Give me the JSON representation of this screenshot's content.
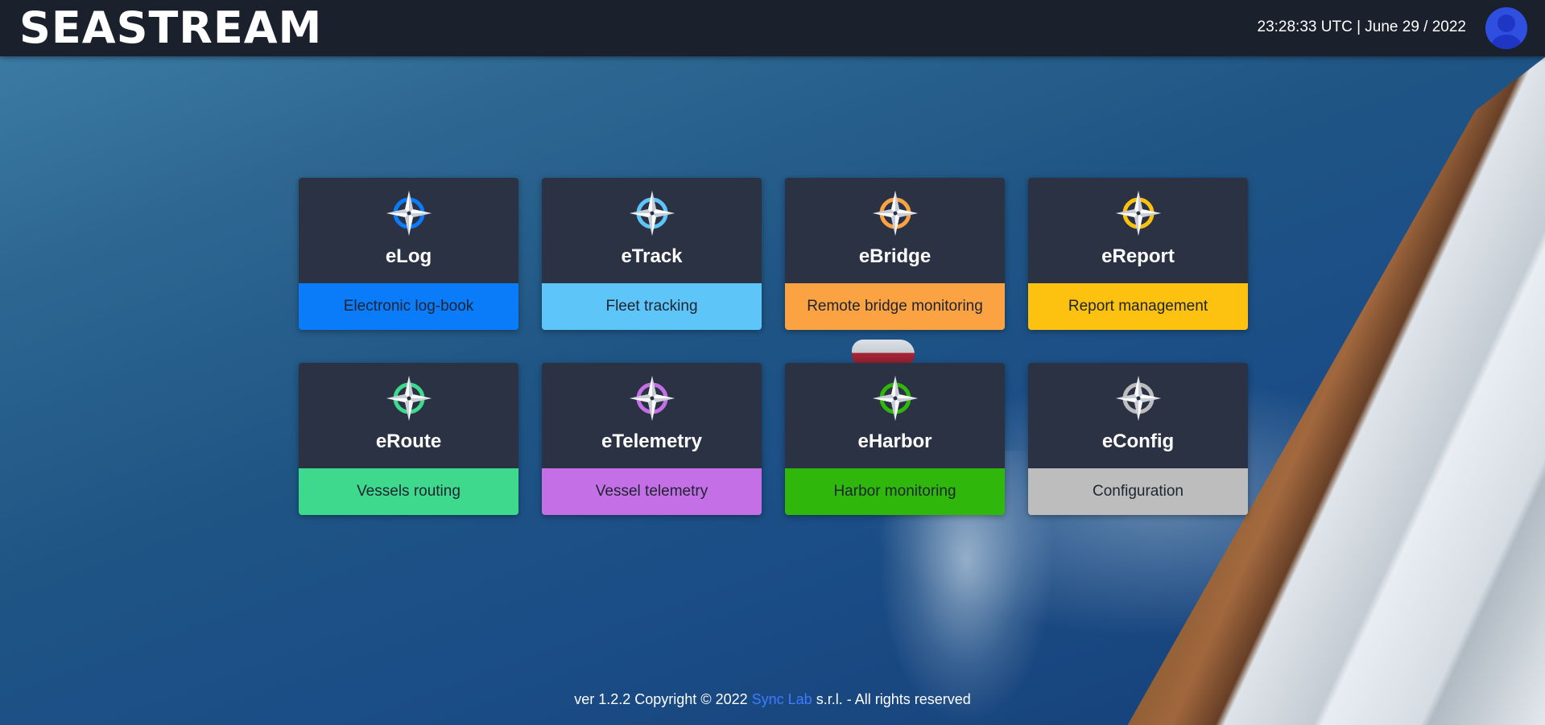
{
  "header": {
    "logo_text": "SEASTREAM",
    "datetime": "23:28:33 UTC | June 29 / 2022",
    "avatar_icon": "user-avatar-icon"
  },
  "modules": [
    {
      "name": "eLog",
      "description": "Electronic log-book",
      "color": "#0a7cf9",
      "icon": "compass-rose-icon"
    },
    {
      "name": "eTrack",
      "description": "Fleet tracking",
      "color": "#5ec5f9",
      "icon": "compass-rose-icon"
    },
    {
      "name": "eBridge",
      "description": "Remote bridge monitoring",
      "color": "#fba243",
      "icon": "compass-rose-icon"
    },
    {
      "name": "eReport",
      "description": "Report management",
      "color": "#fdc10f",
      "icon": "compass-rose-icon"
    },
    {
      "name": "eRoute",
      "description": "Vessels routing",
      "color": "#3ed98c",
      "icon": "compass-rose-icon"
    },
    {
      "name": "eTelemetry",
      "description": "Vessel telemetry",
      "color": "#c46fe5",
      "icon": "compass-rose-icon"
    },
    {
      "name": "eHarbor",
      "description": "Harbor monitoring",
      "color": "#2fb80b",
      "icon": "compass-rose-icon"
    },
    {
      "name": "eConfig",
      "description": "Configuration",
      "color": "#bdbdbd",
      "icon": "compass-rose-icon"
    }
  ],
  "footer": {
    "prefix": "ver 1.2.2 Copyright © 2022 ",
    "link_text": "Sync Lab",
    "suffix": " s.r.l. - All rights reserved"
  }
}
